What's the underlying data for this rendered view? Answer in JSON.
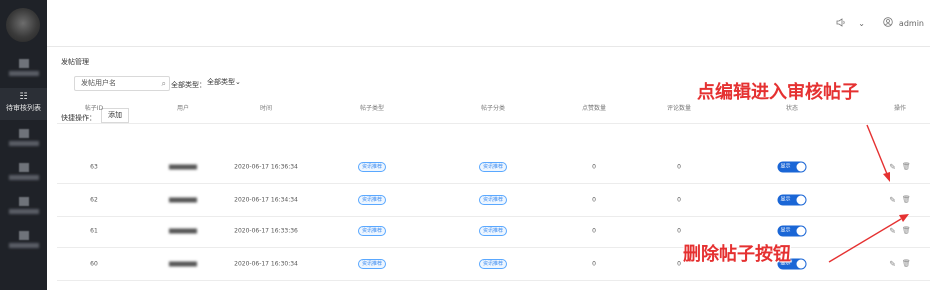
{
  "sidebar": {
    "items": [
      {
        "label": "",
        "icon": "blurred-icon"
      },
      {
        "label": "待审核列表",
        "icon": "grid-icon",
        "active": true
      },
      {
        "label": "",
        "icon": "blurred-icon"
      },
      {
        "label": "",
        "icon": "blurred-icon"
      },
      {
        "label": "",
        "icon": "blurred-icon"
      },
      {
        "label": "",
        "icon": "blurred-icon"
      }
    ]
  },
  "header": {
    "user": "admin",
    "sound_icon": "speaker-icon",
    "user_icon": "user-circle-icon"
  },
  "page": {
    "breadcrumb": "发帖管理",
    "search_placeholder": "发帖用户名",
    "type_label": "全部类型：",
    "type_value": "全部类型",
    "quick_label": "快捷操作：",
    "add_label": "添加"
  },
  "table": {
    "columns": [
      "帖子ID",
      "用户",
      "时间",
      "帖子类型",
      "帖子分类",
      "点赞数量",
      "评论数量",
      "状态",
      "操作"
    ],
    "rows": [
      {
        "id": "63",
        "time": "2020-06-17 16:36:34",
        "type": "资讯推荐",
        "category": "资讯推荐",
        "likes": "0",
        "comments": "0",
        "status": "显示"
      },
      {
        "id": "62",
        "time": "2020-06-17 16:34:34",
        "type": "资讯推荐",
        "category": "资讯推荐",
        "likes": "0",
        "comments": "0",
        "status": "显示"
      },
      {
        "id": "61",
        "time": "2020-06-17 16:33:36",
        "type": "资讯推荐",
        "category": "资讯推荐",
        "likes": "0",
        "comments": "0",
        "status": "显示"
      },
      {
        "id": "60",
        "time": "2020-06-17 16:30:34",
        "type": "资讯推荐",
        "category": "资讯推荐",
        "likes": "0",
        "comments": "0",
        "status": "显示"
      }
    ]
  },
  "annotations": {
    "edit_note": "点编辑进入审核帖子",
    "delete_note": "删除帖子按钮",
    "color": "#e53131"
  }
}
